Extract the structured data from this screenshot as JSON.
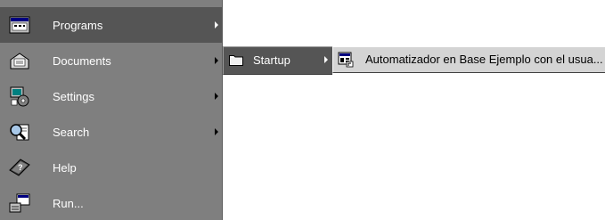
{
  "start_menu": {
    "items": [
      {
        "label": "Programs",
        "icon": "programs-icon",
        "has_submenu": true,
        "selected": true
      },
      {
        "label": "Documents",
        "icon": "documents-icon",
        "has_submenu": true,
        "selected": false
      },
      {
        "label": "Settings",
        "icon": "settings-icon",
        "has_submenu": true,
        "selected": false
      },
      {
        "label": "Search",
        "icon": "search-icon",
        "has_submenu": true,
        "selected": false
      },
      {
        "label": "Help",
        "icon": "help-icon",
        "has_submenu": false,
        "selected": false
      },
      {
        "label": "Run...",
        "icon": "run-icon",
        "has_submenu": false,
        "selected": false
      }
    ]
  },
  "programs_submenu": {
    "items": [
      {
        "label": "Startup",
        "icon": "folder-icon",
        "has_submenu": true,
        "selected": true
      }
    ]
  },
  "startup_submenu": {
    "items": [
      {
        "label": "Automatizador en Base Ejemplo con el usua...",
        "icon": "program-shortcut-icon"
      }
    ]
  },
  "colors": {
    "menu_bg": "#7f7f7f",
    "highlight_bg": "#555555",
    "submenu_bg": "#d4d4d4",
    "text_light": "#ffffff",
    "text_dark": "#000000"
  }
}
